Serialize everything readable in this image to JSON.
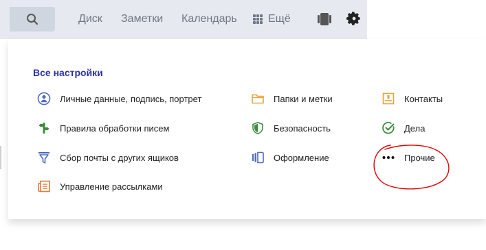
{
  "nav": {
    "links": [
      "Диск",
      "Заметки",
      "Календарь"
    ],
    "more_label": "Ещё",
    "icons": [
      "search-icon",
      "grid-icon",
      "theme-icon",
      "gear-icon"
    ]
  },
  "settings": {
    "title": "Все настройки",
    "items": [
      {
        "label": "Личные данные, подпись, портрет",
        "icon": "user-icon"
      },
      {
        "label": "Правила обработки писем",
        "icon": "sort-icon"
      },
      {
        "label": "Сбор почты с других ящиков",
        "icon": "filter-icon"
      },
      {
        "label": "Управление рассылками",
        "icon": "newsletter-icon"
      },
      {
        "label": "Папки и метки",
        "icon": "folder-icon"
      },
      {
        "label": "Безопасность",
        "icon": "shield-icon"
      },
      {
        "label": "Оформление",
        "icon": "theme-icon"
      },
      {
        "label": "Контакты",
        "icon": "contacts-icon"
      },
      {
        "label": "Дела",
        "icon": "check-icon"
      },
      {
        "label": "Прочие",
        "icon": "more-dots-icon"
      }
    ]
  },
  "colors": {
    "topbar_bg": "#e6e9ef",
    "title": "#2b30a8",
    "blue_icon": "#4f6bbf",
    "green_icon": "#3c8a3c",
    "orange_icon": "#e8a13c",
    "annotation": "#e00000"
  }
}
